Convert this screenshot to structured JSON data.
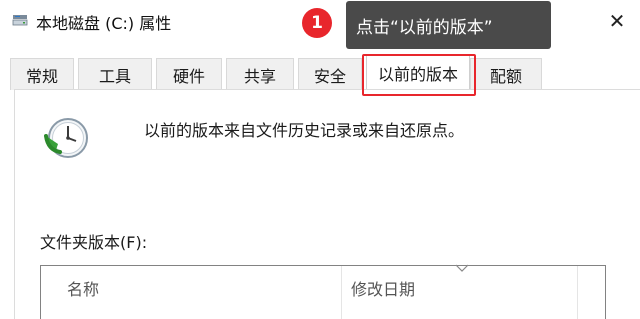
{
  "window": {
    "title": "本地磁盘 (C:) 属性",
    "close_glyph": "✕"
  },
  "tabs": [
    {
      "label": "常规",
      "active": false
    },
    {
      "label": "工具",
      "active": false
    },
    {
      "label": "硬件",
      "active": false
    },
    {
      "label": "共享",
      "active": false
    },
    {
      "label": "安全",
      "active": false
    },
    {
      "label": "以前的版本",
      "active": true
    },
    {
      "label": "配额",
      "active": false
    }
  ],
  "content": {
    "description": "以前的版本来自文件历史记录或来自还原点。",
    "folder_versions_label": "文件夹版本(F):",
    "columns": [
      "名称",
      "修改日期"
    ]
  },
  "annotation": {
    "step_number": "1",
    "callout_text": "点击“以前的版本”",
    "highlight_color": "#e8262c",
    "callout_bg": "#4a4a4a"
  },
  "icons": {
    "title": "drive-icon",
    "content": "restore-clock-icon"
  }
}
